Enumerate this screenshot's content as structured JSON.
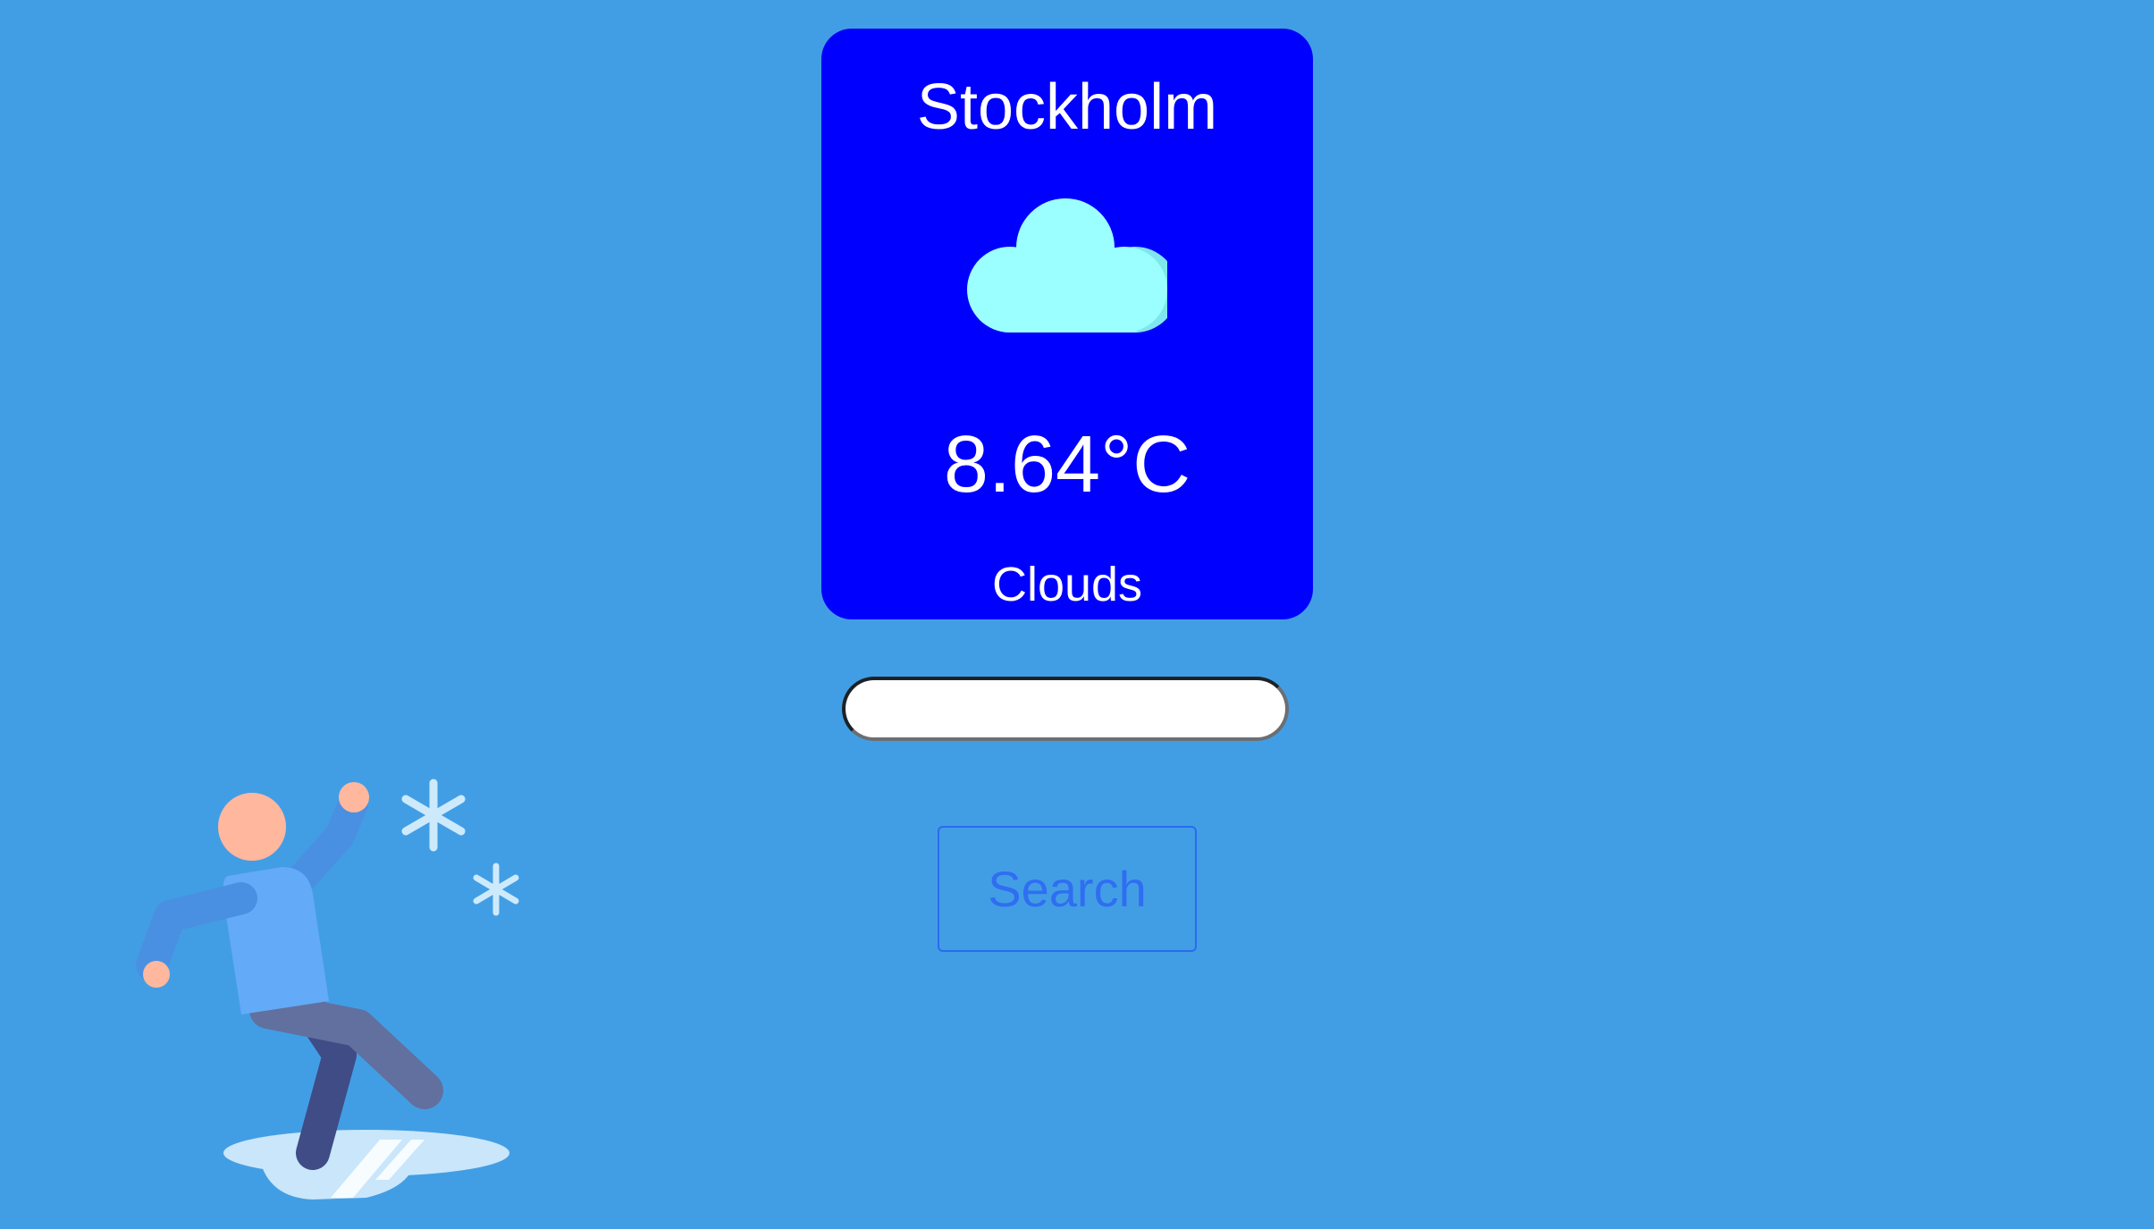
{
  "weather_card": {
    "city": "Stockholm",
    "icon": "cloud-icon",
    "temperature": "8.64°C",
    "description": "Clouds"
  },
  "search": {
    "value": "",
    "placeholder": "",
    "button_label": "Search"
  },
  "illustration": {
    "icon": "person-slipping-on-ice-illustration"
  },
  "colors": {
    "background": "#429ee4",
    "card": "#0000ff",
    "cloud": "#9bffff",
    "button_text": "#2f6ef2"
  }
}
